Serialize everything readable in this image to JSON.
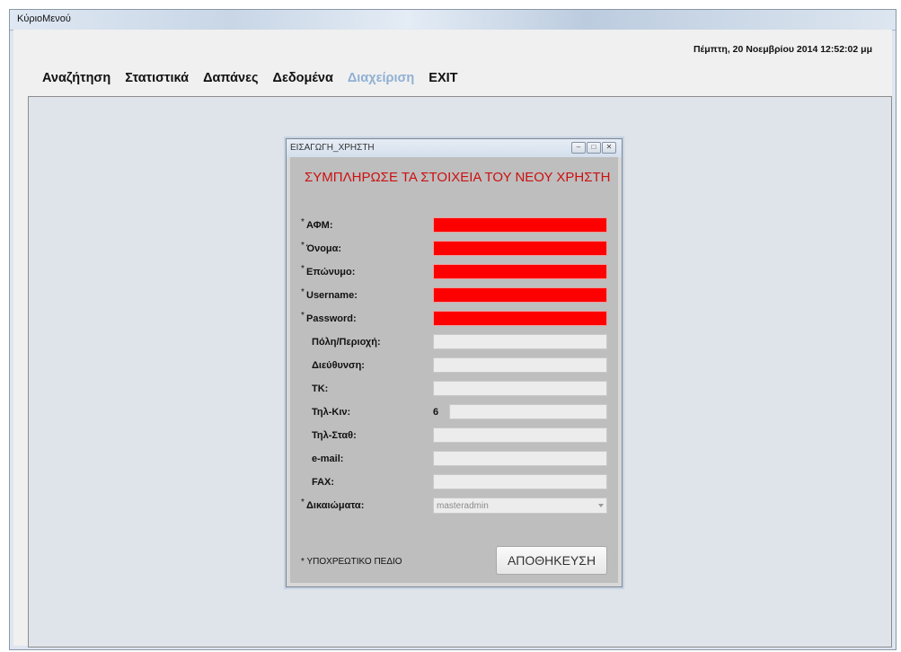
{
  "window": {
    "title": "ΚύριοΜενού"
  },
  "datetime": "Πέμπτη, 20 Νοεμβρίου 2014 12:52:02 μμ",
  "menu": [
    {
      "label": "Αναζήτηση",
      "disabled": false
    },
    {
      "label": "Στατιστικά",
      "disabled": false
    },
    {
      "label": "Δαπάνες",
      "disabled": false
    },
    {
      "label": "Δεδομένα",
      "disabled": false
    },
    {
      "label": "Διαχείριση",
      "disabled": true
    },
    {
      "label": "EXIT",
      "disabled": false
    }
  ],
  "dialog": {
    "title": "ΕΙΣΑΓΩΓΗ_ΧΡΗΣΤΗ",
    "heading": "ΣΥΜΠΛΗΡΩΣΕ ΤΑ ΣΤΟΙΧΕΙΑ ΤΟΥ ΝΕΟΥ ΧΡΗΣΤΗ",
    "required_mark": "*",
    "fields": {
      "afm": {
        "label": "ΑΦΜ:",
        "value": ""
      },
      "onoma": {
        "label": "Όνομα:",
        "value": ""
      },
      "eponymo": {
        "label": "Επώνυμο:",
        "value": ""
      },
      "username": {
        "label": "Username:",
        "value": ""
      },
      "password": {
        "label": "Password:",
        "value": ""
      },
      "poli": {
        "label": "Πόλη/Περιοχή:",
        "value": ""
      },
      "dieythynsi": {
        "label": "Διεύθυνση:",
        "value": ""
      },
      "tk": {
        "label": "ΤΚ:",
        "value": ""
      },
      "til_kin": {
        "label": "Τηλ-Κιν:",
        "prefix": "6",
        "value": ""
      },
      "til_stath": {
        "label": "Τηλ-Σταθ:",
        "value": ""
      },
      "email": {
        "label": "e-mail:",
        "value": ""
      },
      "fax": {
        "label": "FAX:",
        "value": ""
      },
      "dikaiomata": {
        "label": "Δικαιώματα:",
        "selected": "masteradmin"
      }
    },
    "footnote": "* ΥΠΟΧΡΕΩΤΙΚΟ ΠΕΔΙΟ",
    "save_label": "ΑΠΟΘΗΚΕΥΣΗ",
    "colors": {
      "required_field": "#ff0000",
      "heading": "#cc1010",
      "disabled_menu": "#8fb0d3"
    }
  }
}
